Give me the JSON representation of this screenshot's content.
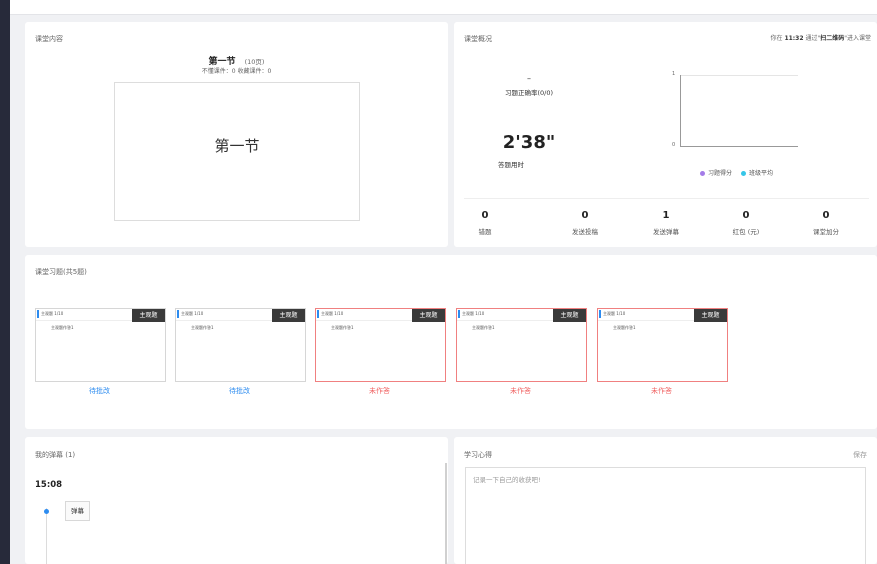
{
  "colors": {
    "accent_blue": "#2d8cf0",
    "pending_red": "#f06262",
    "sidebar_dark": "#272a3a"
  },
  "content": {
    "title": "课堂内容",
    "section_title": "第一节",
    "section_pages": "(10页)",
    "stats_line": "不懂课件：0  收藏课件：0",
    "thumbnail_text": "第一节"
  },
  "overview": {
    "title": "课堂概况",
    "entry_prefix": "你在 ",
    "entry_time": "11:32",
    "entry_mid": " 通过\"",
    "entry_method": "扫二维码",
    "entry_suffix": "\"进入课堂",
    "accuracy_value": "–",
    "accuracy_label": "习题正确率(0/0)",
    "time_value": "2'38\"",
    "time_label": "答题用时",
    "chart": {
      "y_ticks": [
        "1",
        "0"
      ],
      "legend": [
        {
          "label": "习题得分",
          "color": "#a47ce8"
        },
        {
          "label": "班级平均",
          "color": "#36c6e8"
        }
      ]
    },
    "stats": [
      {
        "value": "0",
        "label": "错题"
      },
      {
        "value": "0",
        "label": "发送投稿"
      },
      {
        "value": "1",
        "label": "发送弹幕"
      },
      {
        "value": "0",
        "label": "红包 (元)"
      },
      {
        "value": "0",
        "label": "课堂加分"
      }
    ]
  },
  "exercises": {
    "title": "课堂习题(共5题)",
    "items": [
      {
        "tag": "主观题",
        "header": "主观题  1/10",
        "body": "主观题作答1",
        "status": "待批改",
        "state": "graded"
      },
      {
        "tag": "主观题",
        "header": "主观题  1/10",
        "body": "主观题作答1",
        "status": "待批改",
        "state": "graded"
      },
      {
        "tag": "主观题",
        "header": "主观题  1/10",
        "body": "主观题作答1",
        "status": "未作答",
        "state": "unanswered"
      },
      {
        "tag": "主观题",
        "header": "主观题  1/10",
        "body": "主观题作答1",
        "status": "未作答",
        "state": "unanswered"
      },
      {
        "tag": "主观题",
        "header": "主观题  1/10",
        "body": "主观题作答1",
        "status": "未作答",
        "state": "unanswered"
      }
    ]
  },
  "bullets": {
    "title": "我的弹幕 (1)",
    "time": "15:08",
    "message": "弹幕"
  },
  "notes": {
    "title": "学习心得",
    "save_label": "保存",
    "placeholder": "记录一下自己的收获吧!"
  }
}
